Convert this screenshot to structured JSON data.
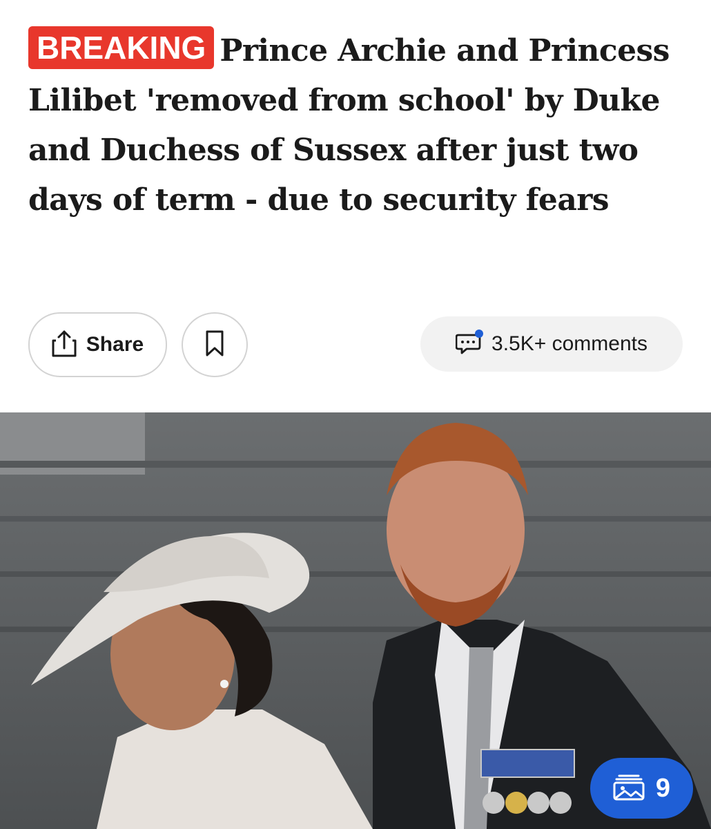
{
  "article": {
    "badge": "BREAKING",
    "headline": "Prince Archie and Princess Lilibet 'removed from school' by Duke and Duchess of Sussex after just two days of term - due to security fears"
  },
  "actions": {
    "share_label": "Share",
    "comments_label": "3.5K+ comments"
  },
  "gallery": {
    "count": "9"
  },
  "colors": {
    "badge": "#e8372c",
    "gallery_button": "#1f5fd6",
    "notification_dot": "#1f5fd6"
  },
  "icons": [
    "share-icon",
    "bookmark-icon",
    "comment-icon",
    "gallery-icon"
  ]
}
